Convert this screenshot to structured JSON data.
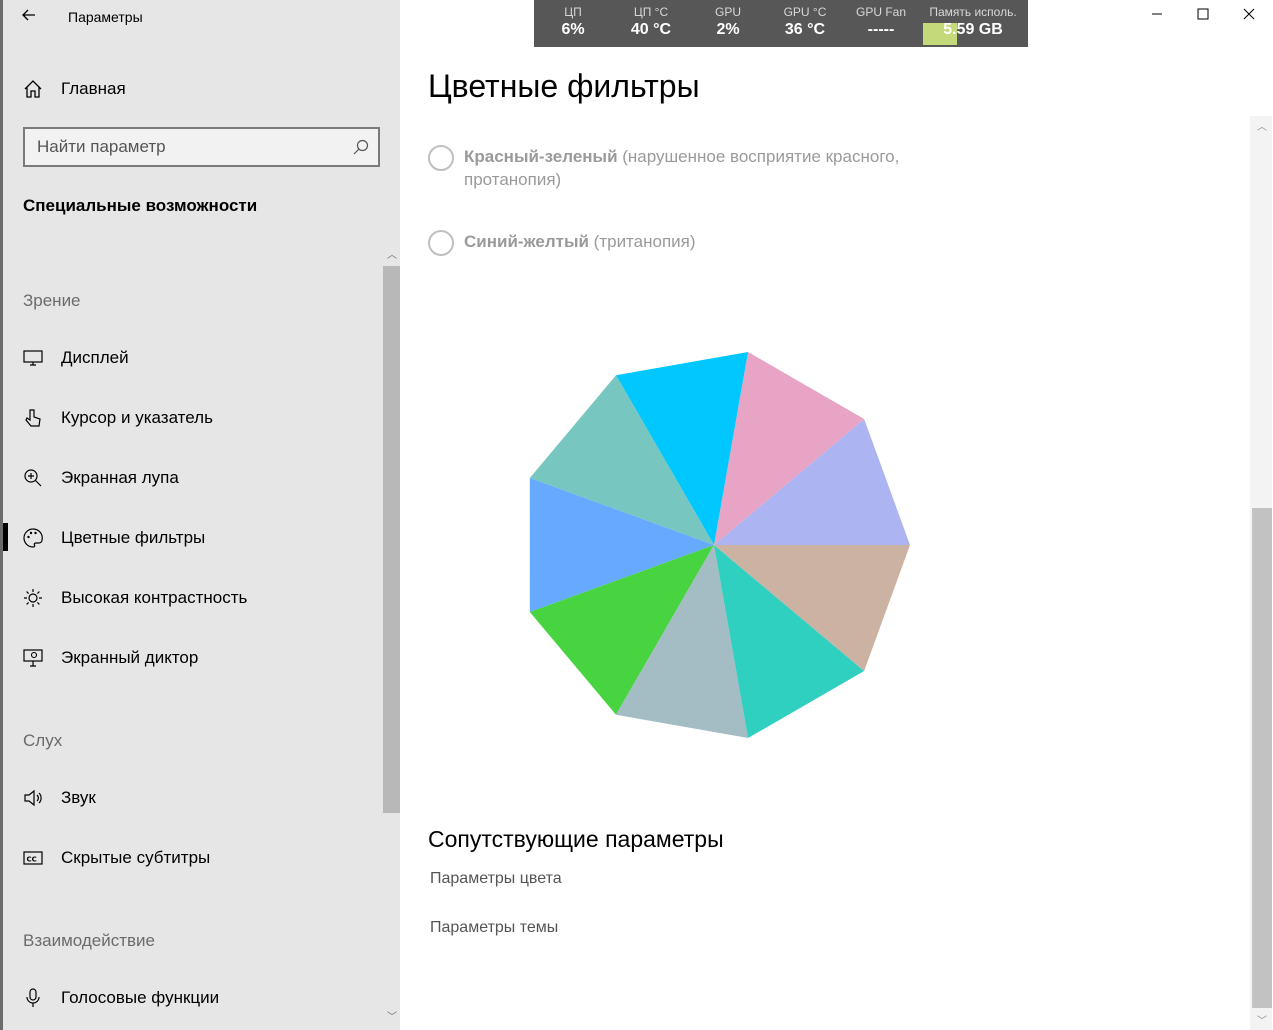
{
  "app": {
    "title": "Параметры",
    "back_label": "←"
  },
  "sidebar": {
    "home_label": "Главная",
    "search_placeholder": "Найти параметр",
    "section_title": "Специальные возможности",
    "groups": {
      "vision": "Зрение",
      "hearing": "Слух",
      "interaction": "Взаимодействие"
    },
    "items": [
      {
        "label": "Дисплей",
        "icon": "display-icon"
      },
      {
        "label": "Курсор и указатель",
        "icon": "cursor-icon"
      },
      {
        "label": "Экранная лупа",
        "icon": "magnifier-icon"
      },
      {
        "label": "Цветные фильтры",
        "icon": "palette-icon",
        "active": true
      },
      {
        "label": "Высокая контрастность",
        "icon": "contrast-icon"
      },
      {
        "label": "Экранный диктор",
        "icon": "narrator-icon"
      },
      {
        "label": "Звук",
        "icon": "speaker-icon"
      },
      {
        "label": "Скрытые субтитры",
        "icon": "closed-captions-icon"
      },
      {
        "label": "Голосовые функции",
        "icon": "microphone-icon"
      }
    ]
  },
  "main": {
    "title": "Цветные фильтры",
    "options": [
      {
        "bold": "Красный-зеленый",
        "rest": " (нарушенное восприятие красного, протанопия)"
      },
      {
        "bold": "Синий-желтый",
        "rest": " (тританопия)"
      }
    ],
    "related_title": "Сопутствующие параметры",
    "links": [
      "Параметры цвета",
      "Параметры темы"
    ]
  },
  "pie": {
    "slices": [
      {
        "color": "#acb4f2"
      },
      {
        "color": "#e8a4c4"
      },
      {
        "color": "#00c8ff"
      },
      {
        "color": "#78c6c0"
      },
      {
        "color": "#66aaff"
      },
      {
        "color": "#48d440"
      },
      {
        "color": "#a4bcc4"
      },
      {
        "color": "#30d0c0"
      },
      {
        "color": "#ccb2a2"
      }
    ]
  },
  "hw_monitor": [
    {
      "label": "ЦП",
      "value": "6%"
    },
    {
      "label": "ЦП °C",
      "value": "40 °C"
    },
    {
      "label": "GPU",
      "value": "2%"
    },
    {
      "label": "GPU °C",
      "value": "36 °C"
    },
    {
      "label": "GPU Fan",
      "value": "-----"
    },
    {
      "label": "Память исполь.",
      "value": "5.59 GB"
    }
  ],
  "window_controls": {
    "minimize": "—",
    "maximize": "☐",
    "close": "✕"
  }
}
